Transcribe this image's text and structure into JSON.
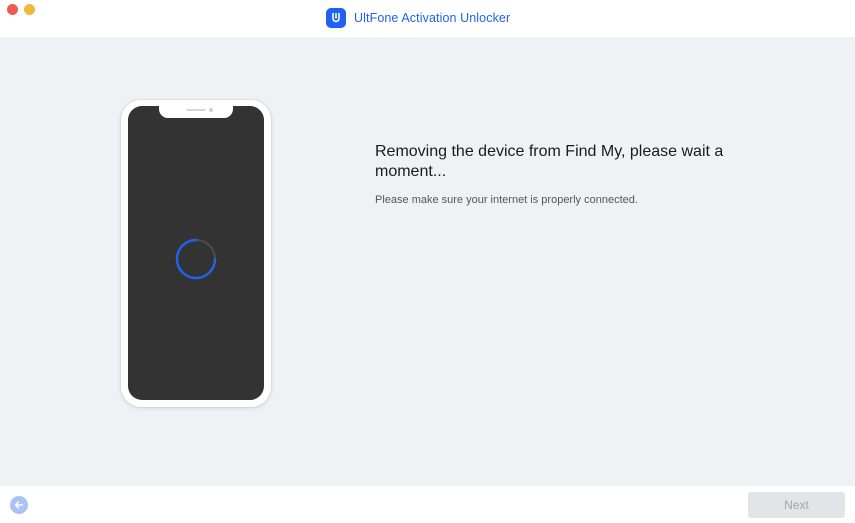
{
  "window": {
    "title": "UltFone Activation Unlocker",
    "logo_icon": "ultfone-logo-icon"
  },
  "colors": {
    "accent": "#1d63f0",
    "close_button": "#ee5a52",
    "minimize_button": "#f2b83a",
    "phone_screen": "#333333",
    "background": "#f0f1f5"
  },
  "main": {
    "heading": "Removing the device from Find My, please wait a moment...",
    "subtext": "Please make sure your internet is properly connected.",
    "spinner_icon": "loading-spinner-icon"
  },
  "footer": {
    "back_icon": "arrow-left-icon",
    "next_label": "Next"
  }
}
